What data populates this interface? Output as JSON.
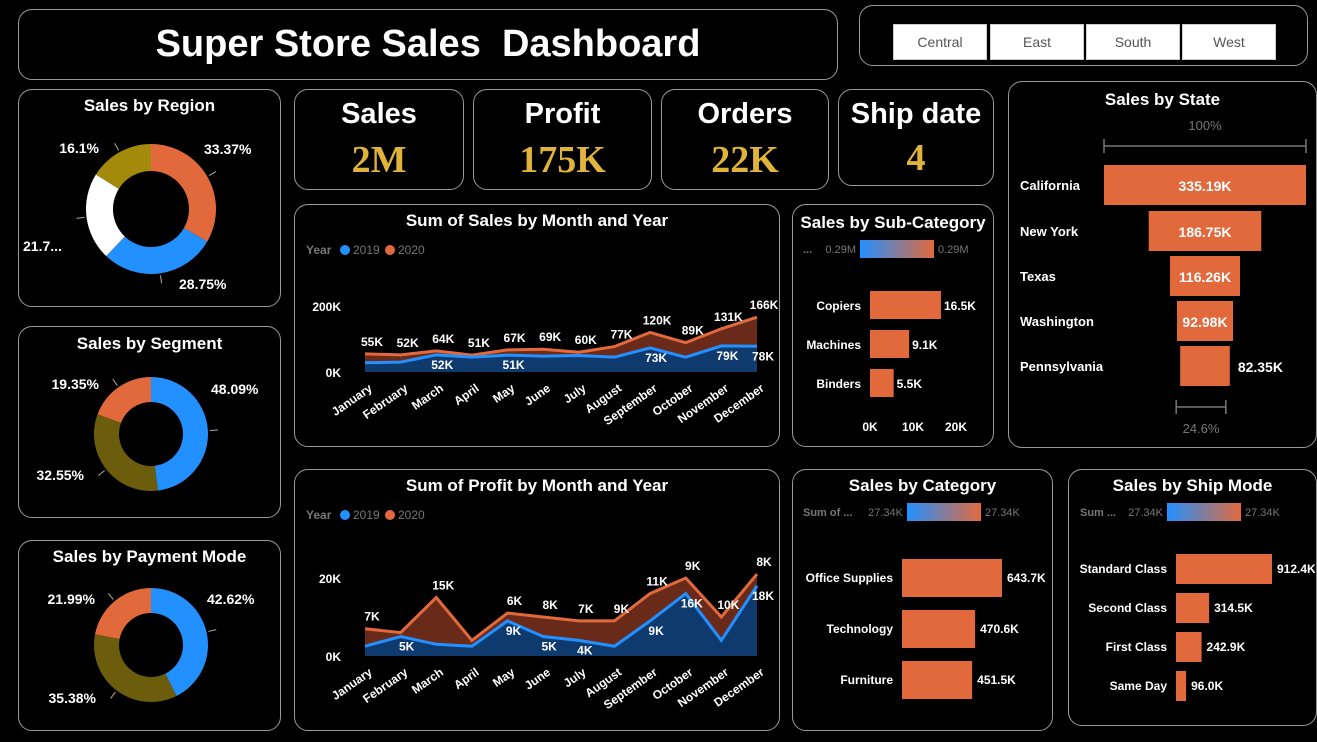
{
  "header": {
    "title": "Super Store Sales  Dashboard"
  },
  "slicer": {
    "options": [
      "Central",
      "East",
      "South",
      "West"
    ]
  },
  "kpis": [
    {
      "label": "Sales",
      "value": "2M"
    },
    {
      "label": "Profit",
      "value": "175K"
    },
    {
      "label": "Orders",
      "value": "22K"
    },
    {
      "label": "Ship date",
      "value": "4"
    }
  ],
  "colors": {
    "orange": "#e2693c",
    "blue": "#2390ff",
    "white": "#ffffff",
    "olive": "#a38a0a",
    "darkOlive": "#6b5d0c",
    "kpiGold": "#e0b43a",
    "area2019": "#0e3a6e",
    "area2020": "#6a2a19"
  },
  "donuts": {
    "region": {
      "title": "Sales by Region",
      "slices": [
        {
          "label": "33.37%",
          "value": 33.37,
          "color": "#e2693c"
        },
        {
          "label": "28.75%",
          "value": 28.75,
          "color": "#2390ff"
        },
        {
          "label": "21.7...",
          "value": 21.78,
          "color": "#ffffff"
        },
        {
          "label": "16.1%",
          "value": 16.1,
          "color": "#a38a0a"
        }
      ]
    },
    "segment": {
      "title": "Sales by Segment",
      "slices": [
        {
          "label": "48.09%",
          "value": 48.09,
          "color": "#2390ff"
        },
        {
          "label": "32.55%",
          "value": 32.55,
          "color": "#6b5d0c"
        },
        {
          "label": "19.35%",
          "value": 19.35,
          "color": "#e2693c"
        }
      ]
    },
    "payment": {
      "title": "Sales by Payment Mode",
      "slices": [
        {
          "label": "42.62%",
          "value": 42.62,
          "color": "#2390ff"
        },
        {
          "label": "35.38%",
          "value": 35.38,
          "color": "#6b5d0c"
        },
        {
          "label": "21.99%",
          "value": 21.99,
          "color": "#e2693c"
        }
      ]
    }
  },
  "chart_data": [
    {
      "type": "area",
      "title": "Sum of Sales by Month and Year",
      "legend_title": "Year",
      "categories": [
        "January",
        "February",
        "March",
        "April",
        "May",
        "June",
        "July",
        "August",
        "September",
        "October",
        "November",
        "December"
      ],
      "yticks": [
        "200K",
        "0K"
      ],
      "ylim": [
        0,
        200
      ],
      "series": [
        {
          "name": "2019",
          "values": [
            28,
            30,
            52,
            45,
            51,
            48,
            50,
            45,
            73,
            45,
            79,
            78
          ],
          "labels": [
            "",
            "",
            "52K",
            "",
            "51K",
            "",
            "",
            "",
            "73K",
            "",
            "79K",
            "78K"
          ]
        },
        {
          "name": "2020",
          "values": [
            55,
            52,
            64,
            51,
            67,
            69,
            60,
            77,
            120,
            89,
            131,
            166
          ],
          "labels": [
            "55K",
            "52K",
            "64K",
            "51K",
            "67K",
            "69K",
            "60K",
            "77K",
            "120K",
            "89K",
            "131K",
            "166K"
          ]
        }
      ]
    },
    {
      "type": "area",
      "title": "Sum of Profit by Month and Year",
      "legend_title": "Year",
      "categories": [
        "January",
        "February",
        "March",
        "April",
        "May",
        "June",
        "July",
        "August",
        "September",
        "October",
        "November",
        "December"
      ],
      "yticks": [
        "20K",
        "0K"
      ],
      "ylim": [
        0,
        20
      ],
      "series": [
        {
          "name": "2019",
          "values": [
            2.5,
            5,
            3,
            2.5,
            9,
            5,
            4,
            2.5,
            9,
            16,
            4,
            18
          ],
          "labels": [
            "",
            "5K",
            "",
            "",
            "9K",
            "5K",
            "4K",
            "",
            "9K",
            "16K",
            "",
            "18K"
          ]
        },
        {
          "name": "2020",
          "values": [
            7,
            6,
            15,
            4,
            11,
            10,
            9,
            9,
            16,
            20,
            10,
            21
          ],
          "labels": [
            "7K",
            "",
            "15K",
            "",
            "6K",
            "8K",
            "7K",
            "9K",
            "11K",
            "9K",
            "10K",
            "8K"
          ]
        }
      ]
    },
    {
      "type": "bar",
      "title": "Sales by Sub-Category",
      "legend_left": "...",
      "legend_min": "0.29M",
      "legend_max": "0.29M",
      "categories": [
        "Copiers",
        "Machines",
        "Binders"
      ],
      "values": [
        16.5,
        9.1,
        5.5
      ],
      "labels": [
        "16.5K",
        "9.1K",
        "5.5K"
      ],
      "xticks": [
        "0K",
        "10K",
        "20K"
      ],
      "xlim": [
        0,
        20
      ]
    },
    {
      "type": "bar",
      "title": "Sales by Category",
      "legend_left": "Sum of ...",
      "legend_min": "27.34K",
      "legend_max": "27.34K",
      "categories": [
        "Office Supplies",
        "Technology",
        "Furniture"
      ],
      "values": [
        643.7,
        470.6,
        451.5
      ],
      "labels": [
        "643.7K",
        "470.6K",
        "451.5K"
      ]
    },
    {
      "type": "bar",
      "title": "Sales by Ship Mode",
      "legend_left": "Sum ...",
      "legend_min": "27.34K",
      "legend_max": "27.34K",
      "categories": [
        "Standard Class",
        "Second Class",
        "First Class",
        "Same Day"
      ],
      "values": [
        912.4,
        314.5,
        242.9,
        96.0
      ],
      "labels": [
        "912.4K",
        "314.5K",
        "242.9K",
        "96.0K"
      ]
    },
    {
      "type": "funnel",
      "title": "Sales by State",
      "top_pct": "100%",
      "bottom_pct": "24.6%",
      "categories": [
        "California",
        "New York",
        "Texas",
        "Washington",
        "Pennsylvania"
      ],
      "values": [
        335.19,
        186.75,
        116.26,
        92.98,
        82.35
      ],
      "labels": [
        "335.19K",
        "186.75K",
        "116.26K",
        "92.98K",
        "82.35K"
      ]
    }
  ]
}
